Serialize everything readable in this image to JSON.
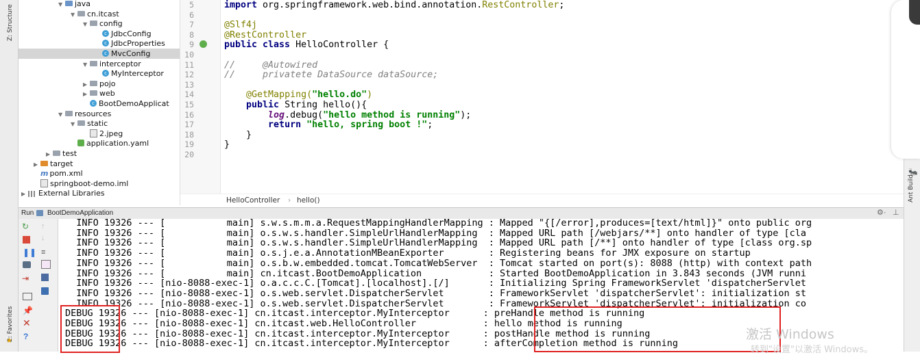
{
  "left_strip": {
    "structure": "Z: Structure",
    "favorites": "2: Favorites"
  },
  "right_strip": {
    "ant_build": "Ant Build"
  },
  "tree": [
    {
      "label": "java",
      "kind": "folder-blue",
      "indent": 0,
      "arrow": "▼"
    },
    {
      "label": "cn.itcast",
      "kind": "folder",
      "indent": 1,
      "arrow": "▼"
    },
    {
      "label": "config",
      "kind": "folder",
      "indent": 2,
      "arrow": "▼"
    },
    {
      "label": "JdbcConfig",
      "kind": "class",
      "indent": 3,
      "arrow": ""
    },
    {
      "label": "JdbcProperties",
      "kind": "class",
      "indent": 3,
      "arrow": ""
    },
    {
      "label": "MvcConfig",
      "kind": "class",
      "indent": 3,
      "arrow": "",
      "selected": true
    },
    {
      "label": "interceptor",
      "kind": "folder",
      "indent": 2,
      "arrow": "▼"
    },
    {
      "label": "MyInterceptor",
      "kind": "class",
      "indent": 3,
      "arrow": ""
    },
    {
      "label": "pojo",
      "kind": "folder",
      "indent": 2,
      "arrow": "▶"
    },
    {
      "label": "web",
      "kind": "folder",
      "indent": 2,
      "arrow": "▶"
    },
    {
      "label": "BootDemoApplicat",
      "kind": "class-run",
      "indent": 2,
      "arrow": ""
    },
    {
      "label": "resources",
      "kind": "folder",
      "indent": 0,
      "arrow": "▼"
    },
    {
      "label": "static",
      "kind": "folder",
      "indent": 1,
      "arrow": "▼"
    },
    {
      "label": "2.jpeg",
      "kind": "image",
      "indent": 2,
      "arrow": ""
    },
    {
      "label": "application.yaml",
      "kind": "yaml",
      "indent": 1,
      "arrow": ""
    },
    {
      "label": "test",
      "kind": "folder",
      "indent": -1,
      "arrow": "▶"
    },
    {
      "label": "target",
      "kind": "folder-orange",
      "indent": -2,
      "arrow": "▶"
    },
    {
      "label": "pom.xml",
      "kind": "maven",
      "indent": -2,
      "arrow": ""
    },
    {
      "label": "springboot-demo.iml",
      "kind": "iml",
      "indent": -2,
      "arrow": ""
    },
    {
      "label": "External Libraries",
      "kind": "lib",
      "indent": -3,
      "arrow": "▶"
    }
  ],
  "editor": {
    "line_numbers": [
      "5",
      "6",
      "7",
      "8",
      "9",
      "10",
      "11",
      "12",
      "13",
      "14",
      "15",
      "16",
      "17",
      "18",
      "19",
      "20"
    ],
    "lines": [
      {
        "parts": [
          {
            "t": "import ",
            "c": "kw"
          },
          {
            "t": "org.springframework.web.bind.annotation.",
            "c": ""
          },
          {
            "t": "RestController",
            "c": "ann"
          },
          {
            "t": ";",
            "c": ""
          }
        ]
      },
      {
        "parts": []
      },
      {
        "parts": [
          {
            "t": "@Slf4j",
            "c": "ann"
          }
        ]
      },
      {
        "parts": [
          {
            "t": "@RestController",
            "c": "ann"
          }
        ]
      },
      {
        "parts": [
          {
            "t": "public class ",
            "c": "kw"
          },
          {
            "t": "HelloController {",
            "c": ""
          }
        ]
      },
      {
        "parts": []
      },
      {
        "parts": [
          {
            "t": "//     @Autowired",
            "c": "cm"
          }
        ]
      },
      {
        "parts": [
          {
            "t": "//     privatete DataSource dataSource;",
            "c": "cm"
          }
        ]
      },
      {
        "parts": []
      },
      {
        "parts": [
          {
            "t": "    ",
            "c": ""
          },
          {
            "t": "@GetMapping(",
            "c": "ann"
          },
          {
            "t": "\"hello.do\"",
            "c": "str"
          },
          {
            "t": ")",
            "c": "ann"
          }
        ]
      },
      {
        "parts": [
          {
            "t": "    ",
            "c": ""
          },
          {
            "t": "public ",
            "c": "kw"
          },
          {
            "t": "String hello(){",
            "c": ""
          }
        ]
      },
      {
        "parts": [
          {
            "t": "        ",
            "c": ""
          },
          {
            "t": "log",
            "c": "log"
          },
          {
            "t": ".debug(",
            "c": ""
          },
          {
            "t": "\"hello method is running\"",
            "c": "str"
          },
          {
            "t": ");",
            "c": ""
          }
        ]
      },
      {
        "parts": [
          {
            "t": "        ",
            "c": ""
          },
          {
            "t": "return ",
            "c": "kw"
          },
          {
            "t": "\"hello, spring boot !\"",
            "c": "str"
          },
          {
            "t": ";",
            "c": ""
          }
        ]
      },
      {
        "parts": [
          {
            "t": "    }",
            "c": ""
          }
        ]
      },
      {
        "parts": [
          {
            "t": "}",
            "c": ""
          }
        ]
      },
      {
        "parts": []
      }
    ]
  },
  "breadcrumb": {
    "file": "HelloController",
    "sep": "›",
    "method": "hello()"
  },
  "run": {
    "label": "Run",
    "config": "BootDemoApplication"
  },
  "console": [
    "  INFO 19326 --- [           main] s.w.s.m.m.a.RequestMappingHandlerMapping : Mapped \"{[/error],produces=[text/html]}\" onto public org",
    "  INFO 19326 --- [           main] o.s.w.s.handler.SimpleUrlHandlerMapping  : Mapped URL path [/webjars/**] onto handler of type [cla",
    "  INFO 19326 --- [           main] o.s.w.s.handler.SimpleUrlHandlerMapping  : Mapped URL path [/**] onto handler of type [class org.sp",
    "  INFO 19326 --- [           main] o.s.j.e.a.AnnotationMBeanExporter        : Registering beans for JMX exposure on startup",
    "  INFO 19326 --- [           main] o.s.b.w.embedded.tomcat.TomcatWebServer  : Tomcat started on port(s): 8088 (http) with context path",
    "  INFO 19326 --- [           main] cn.itcast.BootDemoApplication            : Started BootDemoApplication in 3.843 seconds (JVM runni",
    "  INFO 19326 --- [nio-8088-exec-1] o.a.c.c.C.[Tomcat].[localhost].[/]       : Initializing Spring FrameworkServlet 'dispatcherServlet",
    "  INFO 19326 --- [nio-8088-exec-1] o.s.web.servlet.DispatcherServlet        : FrameworkServlet 'dispatcherServlet': initialization st",
    "  INFO 19326 --- [nio-8088-exec-1] o.s.web.servlet.DispatcherServlet        : FrameworkServlet 'dispatcherServlet': initialization co",
    "DEBUG 19326 --- [nio-8088-exec-1] cn.itcast.interceptor.MyInterceptor      : preHandle method is running",
    "DEBUG 19326 --- [nio-8088-exec-1] cn.itcast.web.HelloController            : hello method is running",
    "DEBUG 19326 --- [nio-8088-exec-1] cn.itcast.interceptor.MyInterceptor      : postHandle method is running",
    "DEBUG 19326 --- [nio-8088-exec-1] cn.itcast.interceptor.MyInterceptor      : afterCompletion method is running"
  ],
  "watermark": {
    "line1": "激活 Windows",
    "line2": "转到\"设置\"以激活 Windows。"
  },
  "colors": {
    "highlight": "#e02020",
    "selection": "#d5d5d5",
    "current_line": "#fffbd6"
  }
}
